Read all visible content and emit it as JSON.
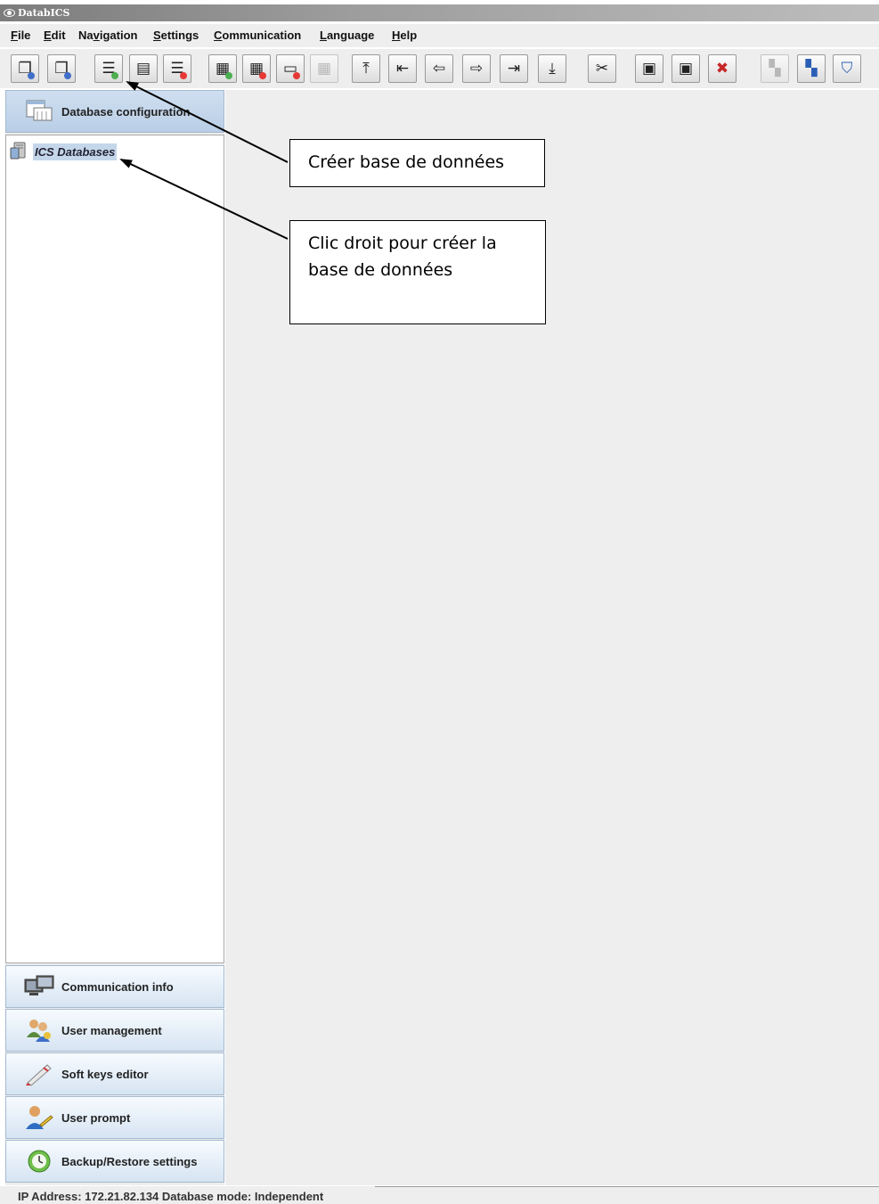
{
  "window": {
    "title": "DatabICS"
  },
  "menu": [
    {
      "label": "File",
      "mnemonic": "F",
      "rest": "ile"
    },
    {
      "label": "Edit",
      "mnemonic": "E",
      "rest": "dit"
    },
    {
      "label": "Navigation",
      "prefix": "Na",
      "mnemonic": "v",
      "rest": "igation"
    },
    {
      "label": "Settings",
      "mnemonic": "S",
      "rest": "ettings"
    },
    {
      "label": "Communication",
      "mnemonic": "C",
      "rest": "ommunication"
    },
    {
      "label": "Language",
      "mnemonic": "L",
      "rest": "anguage"
    },
    {
      "label": "Help",
      "mnemonic": "H",
      "rest": "elp"
    }
  ],
  "toolbar": {
    "icons": [
      "connect-icon",
      "disconnect-icon",
      "create-database-icon",
      "database-table-icon",
      "delete-database-icon",
      "new-record-icon",
      "delete-record-icon",
      "remove-record-icon",
      "record-disabled-icon",
      "first-record-icon",
      "previous-page-icon",
      "previous-record-icon",
      "next-record-icon",
      "last-record-icon",
      "download-icon",
      "tools-icon",
      "import-icon",
      "export-icon",
      "clear-icon",
      "sync-disabled-icon",
      "transfer-icon",
      "security-shield-icon"
    ]
  },
  "sidebar": {
    "top_button": "Database configuration",
    "tree_root": "ICS Databases",
    "bottom_buttons": [
      {
        "label": "Communication info",
        "icon": "monitors-icon"
      },
      {
        "label": "User management",
        "icon": "users-icon"
      },
      {
        "label": "Soft keys editor",
        "icon": "pen-icon"
      },
      {
        "label": "User prompt",
        "icon": "user-prompt-icon"
      },
      {
        "label": "Backup/Restore settings",
        "icon": "backup-clock-icon"
      }
    ]
  },
  "status": {
    "text": "IP Address: 172.21.82.134  Database mode: Independent"
  },
  "annotations": {
    "create_db": "Créer base de données",
    "right_click_line1": "Clic droit pour créer la",
    "right_click_line2": "base de données"
  },
  "colors": {
    "title_bar": "#8c8c8c",
    "nav_button": "#d6e4f2",
    "tree_selection": "#c4d6ea"
  }
}
